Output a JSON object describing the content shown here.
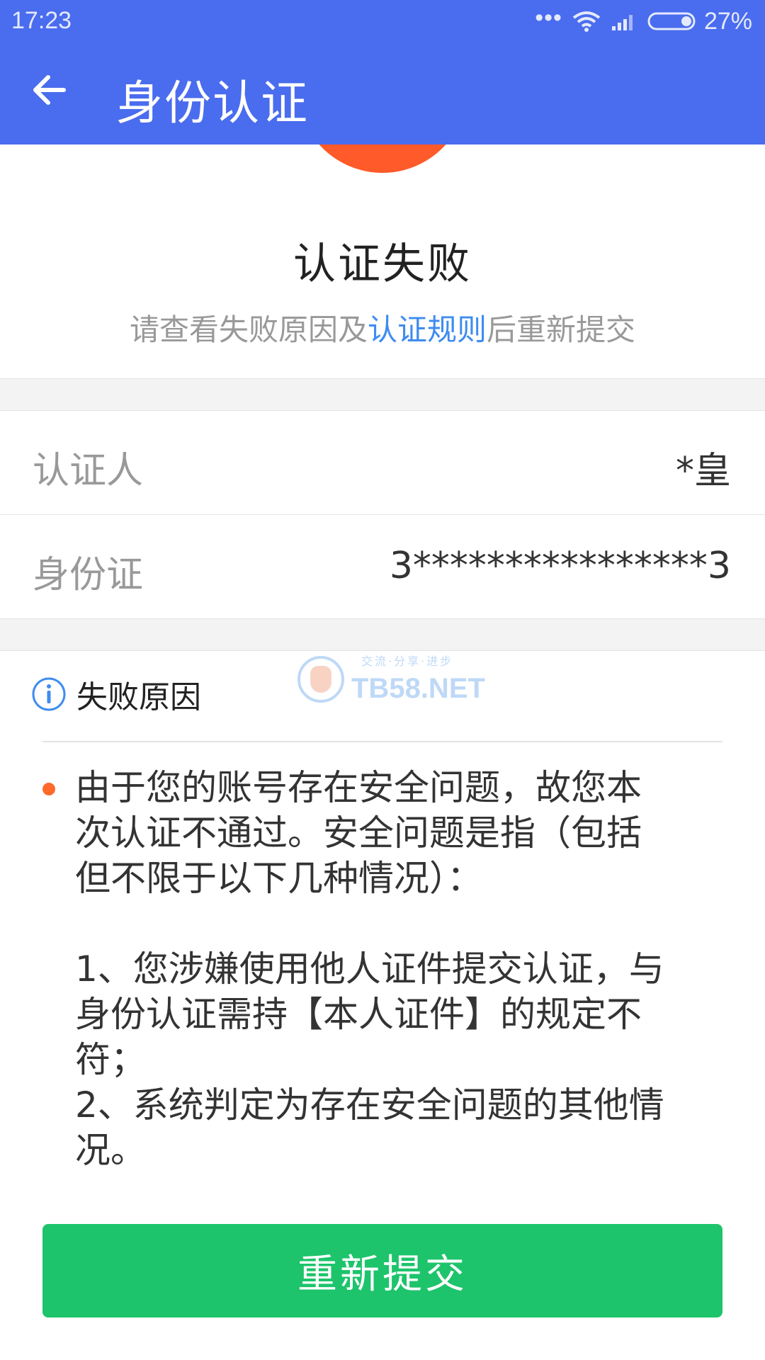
{
  "status_bar": {
    "time": "17:23",
    "battery": "27%",
    "icons": [
      "more-dots-icon",
      "wifi-icon",
      "signal-icon",
      "battery-icon"
    ]
  },
  "app_bar": {
    "title": "身份认证",
    "back_icon": "arrow-left-icon",
    "bg_color": "#4A6CEE"
  },
  "result": {
    "title": "认证失败",
    "subtitle_prefix": "请查看失败原因及",
    "subtitle_link": "认证规则",
    "subtitle_suffix": "后重新提交",
    "icon_color": "#FF5A29",
    "link_color": "#3E8CF0"
  },
  "info": [
    {
      "label": "认证人",
      "value": "*皇"
    },
    {
      "label": "身份证",
      "value": "3****************3"
    }
  ],
  "reason": {
    "title": "失败原因",
    "icon": "info-icon",
    "watermark": {
      "tagline": "交流·分享·进步",
      "text": "TB58.NET"
    },
    "lines": [
      "由于您的账号存在安全问题，故您本",
      "次认证不通过。安全问题是指（包括",
      "但不限于以下几种情况）：",
      "",
      "1、您涉嫌使用他人证件提交认证，与",
      "身份认证需持【本人证件】的规定不",
      "符；",
      "2、系统判定为存在安全问题的其他情",
      "况。"
    ],
    "bullet_color": "#FF6A2B"
  },
  "submit": {
    "label": "重新提交",
    "color": "#1DC46B"
  }
}
